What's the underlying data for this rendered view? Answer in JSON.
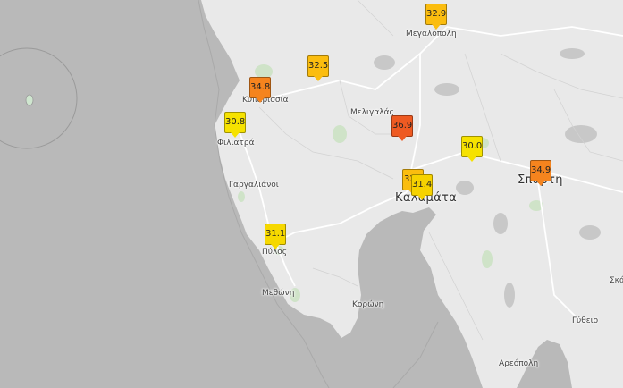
{
  "places": [
    {
      "id": "megalopoli",
      "name": "Μεγαλόπολη"
    },
    {
      "id": "kyparissia",
      "name": "Κυπαρισσία"
    },
    {
      "id": "meligalas",
      "name": "Μελιγαλάς"
    },
    {
      "id": "filiatra",
      "name": "Φιλιατρά"
    },
    {
      "id": "gargalianoi",
      "name": "Γαργαλιάνοι"
    },
    {
      "id": "kalamata",
      "name": "Καλαμάτα"
    },
    {
      "id": "sparti",
      "name": "Σπάρτη"
    },
    {
      "id": "pylos",
      "name": "Πύλος"
    },
    {
      "id": "methoni",
      "name": "Μεθώνη"
    },
    {
      "id": "koroni",
      "name": "Κορώνη"
    },
    {
      "id": "gytheio",
      "name": "Γύθειο"
    },
    {
      "id": "areopoli",
      "name": "Αρεόπολη"
    },
    {
      "id": "skala",
      "name": "Σκά"
    }
  ],
  "stations": [
    {
      "id": "megalopoli",
      "value": "32.9",
      "color": "#fbbd0f"
    },
    {
      "id": "kyparissia-north",
      "value": "32.5",
      "color": "#fbbd0f"
    },
    {
      "id": "kyparissia",
      "value": "34.8",
      "color": "#f5841e"
    },
    {
      "id": "filiatra",
      "value": "30.8",
      "color": "#f6e200"
    },
    {
      "id": "meligalas",
      "value": "36.9",
      "color": "#ee5a22"
    },
    {
      "id": "east-meligalas",
      "value": "30.0",
      "color": "#f6e200"
    },
    {
      "id": "sparti",
      "value": "34.9",
      "color": "#f5841e"
    },
    {
      "id": "kalamata-west",
      "value": "32",
      "color": "#fbbd0f"
    },
    {
      "id": "kalamata",
      "value": "31.4",
      "color": "#f6d200"
    },
    {
      "id": "pylos",
      "value": "31.1",
      "color": "#f6d800"
    }
  ]
}
